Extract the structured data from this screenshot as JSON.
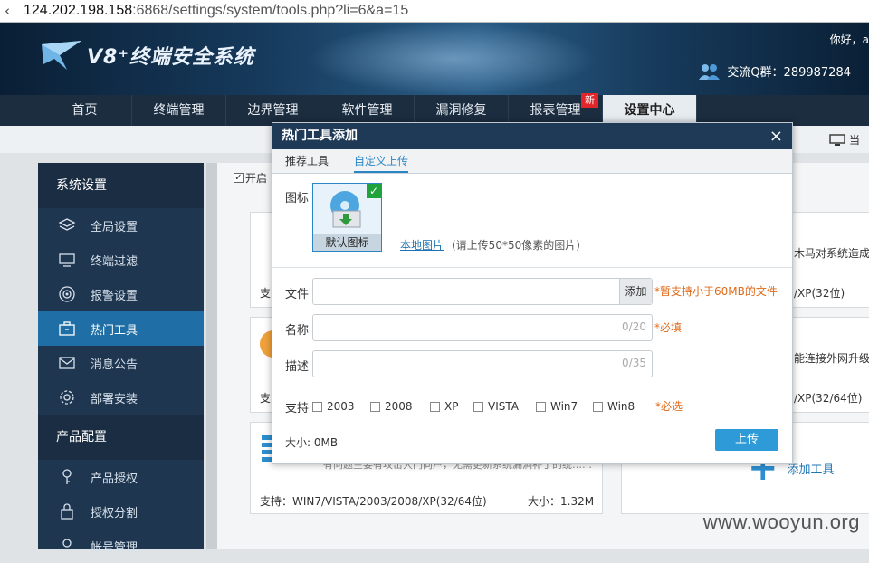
{
  "browser": {
    "url_host": "124.202.198.158",
    "url_path": ":6868/settings/system/tools.php?li=6&a=15"
  },
  "header": {
    "logo_text": "V8⁺终端安全系统",
    "greeting": "你好，a",
    "qq_group": "交流Q群：289987284"
  },
  "nav": {
    "items": [
      {
        "label": "首页"
      },
      {
        "label": "终端管理"
      },
      {
        "label": "边界管理"
      },
      {
        "label": "软件管理"
      },
      {
        "label": "漏洞修复"
      },
      {
        "label": "报表管理",
        "badge": "新"
      },
      {
        "label": "设置中心",
        "active": true
      }
    ],
    "monitor_text": "当"
  },
  "sidebar": {
    "section1_title": "系统设置",
    "section1_items": [
      {
        "label": "全局设置",
        "icon": "layers-icon"
      },
      {
        "label": "终端过滤",
        "icon": "monitor-filter-icon"
      },
      {
        "label": "报警设置",
        "icon": "target-icon"
      },
      {
        "label": "热门工具",
        "icon": "toolbox-icon",
        "active": true
      },
      {
        "label": "消息公告",
        "icon": "mail-icon"
      },
      {
        "label": "部署安装",
        "icon": "gear-icon"
      }
    ],
    "section2_title": "产品配置",
    "section2_items": [
      {
        "label": "产品授权",
        "icon": "key-icon"
      },
      {
        "label": "授权分割",
        "icon": "lock-icon"
      },
      {
        "label": "帐号管理",
        "icon": "user-icon"
      }
    ]
  },
  "content": {
    "enable_checkbox_label": "开启",
    "card1_support": "支",
    "card1_right_text": "木马对系统造成",
    "card1_right_os": "/XP(32位)",
    "card2_support": "支",
    "card2_right_text": "能连接外网升级",
    "card2_right_os": "/XP(32/64位)",
    "card3_desc": "有问题主要有攻击大门向户，无需更新系统漏洞补丁的统……",
    "card3_support": "支持：WIN7/VISTA/2003/2008/XP(32/64位)",
    "card3_size": "大小：1.32M",
    "add_tool_label": "添加工具"
  },
  "modal": {
    "title": "热门工具添加",
    "close_symbol": "×",
    "tabs": [
      {
        "label": "推荐工具"
      },
      {
        "label": "自定义上传",
        "active": true
      }
    ],
    "icon_label": "图标",
    "default_icon_caption": "默认图标",
    "local_picture_link": "本地图片",
    "icon_hint": "(请上传50*50像素的图片)",
    "file_label": "文件",
    "file_add_button": "添加",
    "file_note": "*暂支持小于60MB的文件",
    "name_label": "名称",
    "name_count": "0/20",
    "name_required": "*必填",
    "desc_label": "描述",
    "desc_count": "0/35",
    "support_label": "支持",
    "os_options": [
      {
        "label": "2003",
        "checked": false
      },
      {
        "label": "2008",
        "checked": false
      },
      {
        "label": "XP",
        "checked": false
      },
      {
        "label": "VISTA",
        "checked": false
      },
      {
        "label": "Win7",
        "checked": false
      },
      {
        "label": "Win8",
        "checked": false
      }
    ],
    "os_required": "*必选",
    "size_text": "大小: 0MB",
    "upload_button": "上传"
  },
  "watermark": "www.wooyun.org",
  "colors": {
    "nav_bg": "#1c2d40",
    "sidebar_bg": "#1f3650",
    "sidebar_active": "#1f6ea6",
    "modal_title_bg": "#1f3a57",
    "link_blue": "#2b86c5",
    "required_orange": "#e06a1a",
    "upload_button": "#2e9ad7"
  }
}
